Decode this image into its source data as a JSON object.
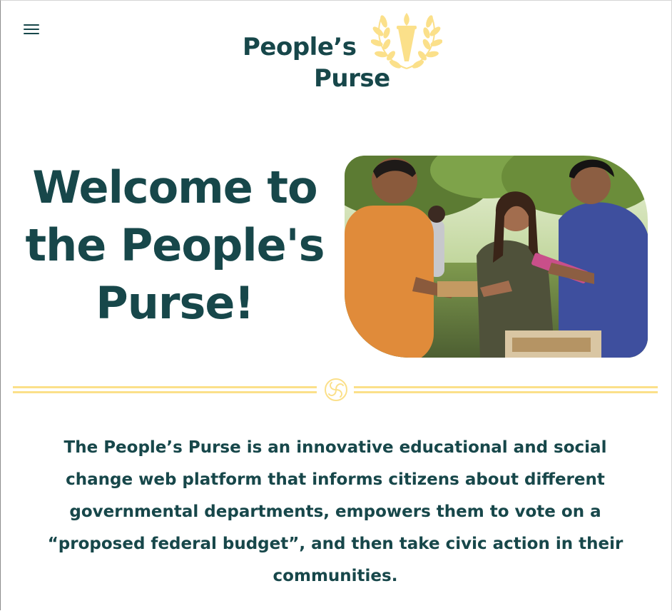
{
  "header": {
    "menu_icon": "hamburger-menu-icon",
    "logo": {
      "line1": "People’s",
      "line2": "Purse",
      "emblem_icon": "laurel-torch-icon"
    }
  },
  "hero": {
    "title": "Welcome to the People's Purse!",
    "image_description_icon": "volunteers-photo"
  },
  "divider": {
    "icon": "swirl-ornament-icon"
  },
  "intro": {
    "text": "The People’s Purse is an innovative educational and social change web platform that informs citizens about different governmental departments, empowers them to vote on a “proposed federal budget”, and then take civic action in their communities."
  },
  "colors": {
    "primary": "#17474a",
    "accent": "#fbe08a",
    "background": "#ffffff"
  }
}
